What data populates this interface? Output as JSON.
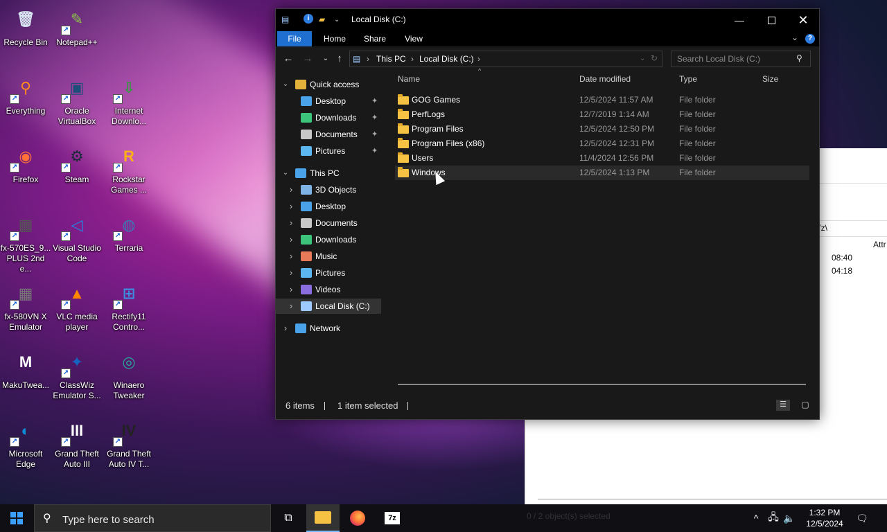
{
  "desktop": {
    "icons": [
      {
        "label": "Recycle Bin",
        "glyph": "🗑",
        "color": "#d9e6f2",
        "shortcut": false
      },
      {
        "label": "Notepad++",
        "glyph": "✎",
        "color": "#8bc34a",
        "shortcut": true
      },
      {
        "label": "Everything",
        "glyph": "⚲",
        "color": "#ff8a1a",
        "shortcut": true
      },
      {
        "label": "Oracle VirtualBox",
        "glyph": "▣",
        "color": "#1f4e79",
        "shortcut": true
      },
      {
        "label": "Internet Downlo...",
        "glyph": "⇩",
        "color": "#2e9e3b",
        "shortcut": true
      },
      {
        "label": "Firefox",
        "glyph": "◉",
        "color": "#ff7139",
        "shortcut": true
      },
      {
        "label": "Steam",
        "glyph": "⚙",
        "color": "#1b2838",
        "shortcut": true
      },
      {
        "label": "Rockstar Games ...",
        "glyph": "R",
        "color": "#fcaf17",
        "shortcut": true
      },
      {
        "label": "fx-570ES_9... PLUS 2nd e...",
        "glyph": "▦",
        "color": "#555555",
        "shortcut": true
      },
      {
        "label": "Visual Studio Code",
        "glyph": "◁",
        "color": "#1e88e5",
        "shortcut": true
      },
      {
        "label": "Terraria",
        "glyph": "◍",
        "color": "#3a7bb5",
        "shortcut": true
      },
      {
        "label": "fx-580VN X Emulator",
        "glyph": "▦",
        "color": "#777777",
        "shortcut": true
      },
      {
        "label": "VLC media player",
        "glyph": "▲",
        "color": "#ff8800",
        "shortcut": true
      },
      {
        "label": "Rectify11 Contro...",
        "glyph": "⊞",
        "color": "#3d8be0",
        "shortcut": true
      },
      {
        "label": "MakuTwea...",
        "glyph": "M",
        "color": "#ffffff",
        "shortcut": false
      },
      {
        "label": "ClassWiz Emulator S...",
        "glyph": "✦",
        "color": "#1565c0",
        "shortcut": true
      },
      {
        "label": "Winaero Tweaker",
        "glyph": "◎",
        "color": "#26a69a",
        "shortcut": false
      },
      {
        "label": "Microsoft Edge",
        "glyph": "◐",
        "color": "#0f8bd6",
        "shortcut": true
      },
      {
        "label": "Grand Theft Auto III",
        "glyph": "III",
        "color": "#ffffff",
        "shortcut": true
      },
      {
        "label": "Grand Theft Auto IV T...",
        "glyph": "IV",
        "color": "#222222",
        "shortcut": true
      }
    ]
  },
  "background_window": {
    "path_fragment": "7z\\",
    "column": "Attr",
    "time1": "08:40",
    "time2": "04:18"
  },
  "explorer": {
    "title": "Local Disk (C:)",
    "ribbon_tabs": [
      "File",
      "Home",
      "Share",
      "View"
    ],
    "breadcrumb": [
      "This PC",
      "Local Disk (C:)"
    ],
    "search_placeholder": "Search Local Disk (C:)",
    "columns": {
      "name": "Name",
      "date": "Date modified",
      "type": "Type",
      "size": "Size"
    },
    "files": [
      {
        "name": "GOG Games",
        "date": "12/5/2024 11:57 AM",
        "type": "File folder"
      },
      {
        "name": "PerfLogs",
        "date": "12/7/2019 1:14 AM",
        "type": "File folder"
      },
      {
        "name": "Program Files",
        "date": "12/5/2024 12:50 PM",
        "type": "File folder"
      },
      {
        "name": "Program Files (x86)",
        "date": "12/5/2024 12:31 PM",
        "type": "File folder"
      },
      {
        "name": "Users",
        "date": "11/4/2024 12:56 PM",
        "type": "File folder"
      },
      {
        "name": "Windows",
        "date": "12/5/2024 1:13 PM",
        "type": "File folder"
      }
    ],
    "nav": {
      "quick_access": "Quick access",
      "quick_items": [
        "Desktop",
        "Downloads",
        "Documents",
        "Pictures"
      ],
      "this_pc": "This PC",
      "pc_items": [
        "3D Objects",
        "Desktop",
        "Documents",
        "Downloads",
        "Music",
        "Pictures",
        "Videos",
        "Local Disk (C:)"
      ],
      "network": "Network"
    },
    "status": {
      "count": "6 items",
      "selected": "1 item selected"
    }
  },
  "taskbar": {
    "search_placeholder": "Type here to search",
    "faint_text": "0 / 2 object(s) selected",
    "time": "1:32 PM",
    "date": "12/5/2024"
  },
  "colors": {
    "accent": "#1f6fd0",
    "folder": "#f5c243",
    "explorer_bg": "#191919"
  }
}
